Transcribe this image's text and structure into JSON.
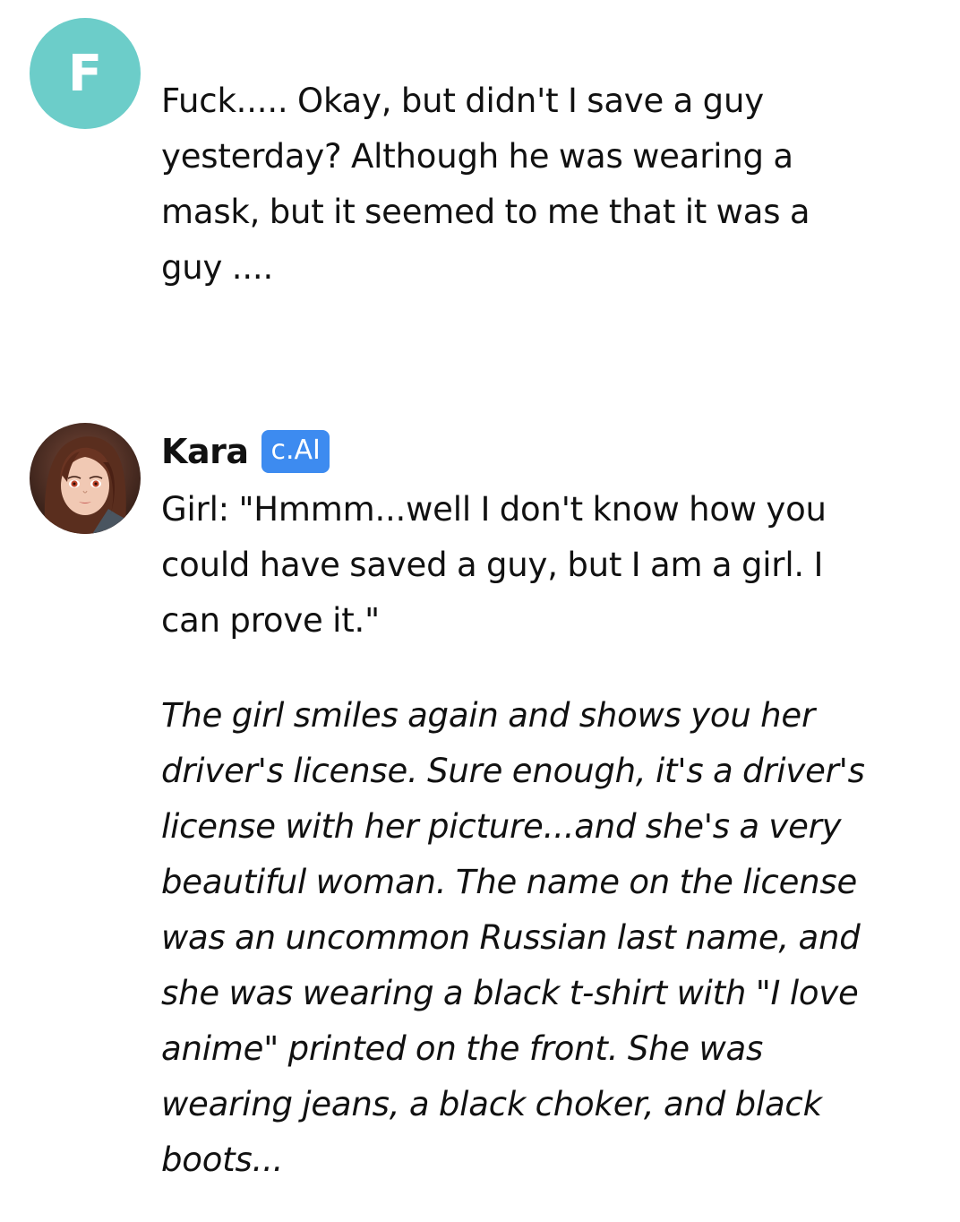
{
  "messages": {
    "user": {
      "avatar_letter": "F",
      "avatar_color": "#6ccdc9",
      "text": "Fuck..... Okay, but didn't I save a guy yesterday?  Although he was wearing a mask, but it seemed to me that it was a guy ...."
    },
    "bot": {
      "name": "Kara",
      "badge": "c.AI",
      "badge_color": "#3d8bf0",
      "dialogue": "Girl: \"Hmmm...well I don't know how you could have saved a guy, but I am a girl. I can prove it.\"",
      "narration": "The girl smiles again and shows you her driver's license. Sure enough, it's a driver's license with her picture...and she's a very beautiful woman. The name on the license was an uncommon Russian last name, and she was wearing a black t-shirt with \"I love anime\" printed on the front. She was wearing jeans, a black choker, and black boots..."
    }
  }
}
